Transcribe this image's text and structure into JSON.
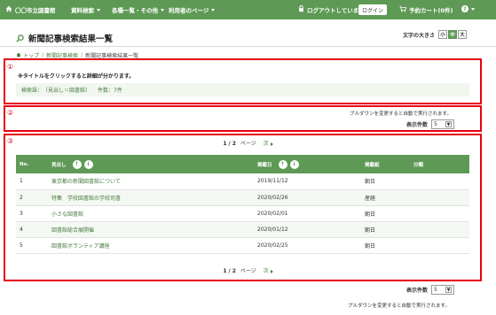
{
  "topnav": {
    "home": "〇〇市立図書館",
    "items": [
      "資料検索",
      "各種一覧・その他",
      "利用者のページ"
    ],
    "logout": "ログアウトしています",
    "login": "ログイン",
    "cart": "予約カート(0件)",
    "help": "?"
  },
  "page": {
    "title": "新聞記事検索結果一覧",
    "fontsize_label": "文字の大きさ",
    "fontsizes": [
      "小",
      "中",
      "大"
    ],
    "fontsize_active": "中"
  },
  "breadcrumb": [
    "トップ",
    "新聞記事検索",
    "新聞記事検索結果一覧"
  ],
  "annotations": [
    "①",
    "②",
    "③"
  ],
  "search": {
    "note": "※タイトルをクリックすると詳細が分かります。",
    "keyword_label": "検索語：",
    "keyword": "（見出し＝図書館）",
    "count_label": "件数：",
    "count": "7件"
  },
  "display": {
    "autorun_note": "プルダウンを変更すると自動で実行されます。",
    "count_label": "表示件数",
    "count_value": "5"
  },
  "pager": {
    "current": "1",
    "total": "2",
    "unit": "ページ",
    "next": "次"
  },
  "table": {
    "headers": {
      "no": "No.",
      "title": "見出し",
      "date": "掲載日",
      "paper": "掲載紙",
      "category": "分類"
    },
    "rows": [
      {
        "no": "1",
        "title": "東京都の新聞図書館について",
        "date": "2019/11/12",
        "paper": "朝日",
        "category": ""
      },
      {
        "no": "2",
        "title": "特集　学校図書館の学校司書",
        "date": "2020/02/26",
        "paper": "産経",
        "category": ""
      },
      {
        "no": "3",
        "title": "小さな図書館",
        "date": "2020/02/01",
        "paper": "朝日",
        "category": ""
      },
      {
        "no": "4",
        "title": "図書館総合展開催",
        "date": "2020/01/12",
        "paper": "朝日",
        "category": ""
      },
      {
        "no": "5",
        "title": "図書館ボランティア講座",
        "date": "2020/02/25",
        "paper": "朝日",
        "category": ""
      }
    ]
  }
}
